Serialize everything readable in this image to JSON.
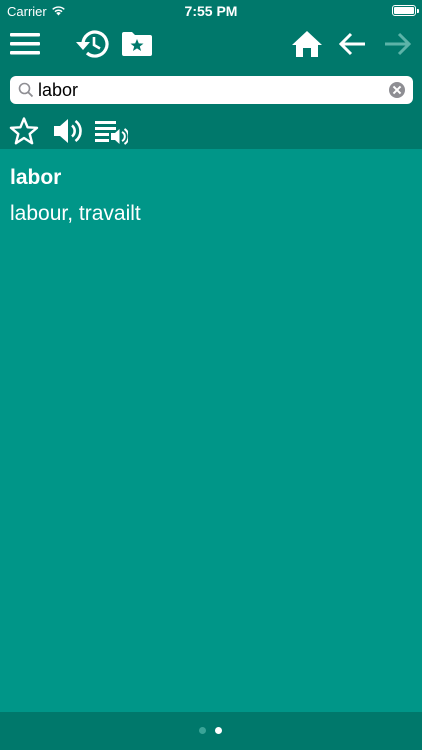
{
  "status_bar": {
    "carrier": "Carrier",
    "time": "7:55 PM",
    "icons": [
      "wifi-icon",
      "battery-icon"
    ]
  },
  "toolbar": {
    "icons": [
      "menu-icon",
      "history-icon",
      "favorites-folder-icon",
      "home-icon",
      "back-arrow-icon",
      "forward-arrow-icon"
    ],
    "forward_disabled": true
  },
  "search": {
    "value": "labor",
    "placeholder": ""
  },
  "actions": {
    "icons": [
      "star-icon",
      "speaker-icon",
      "playlist-audio-icon"
    ]
  },
  "entry": {
    "headword": "labor",
    "translation": "labour, travailt"
  },
  "pager": {
    "pages": 2,
    "current": 2
  },
  "colors": {
    "toolbar": "#00786b",
    "content": "#009688",
    "text": "#ffffff",
    "disabled_icon": "#5cb3a8"
  }
}
